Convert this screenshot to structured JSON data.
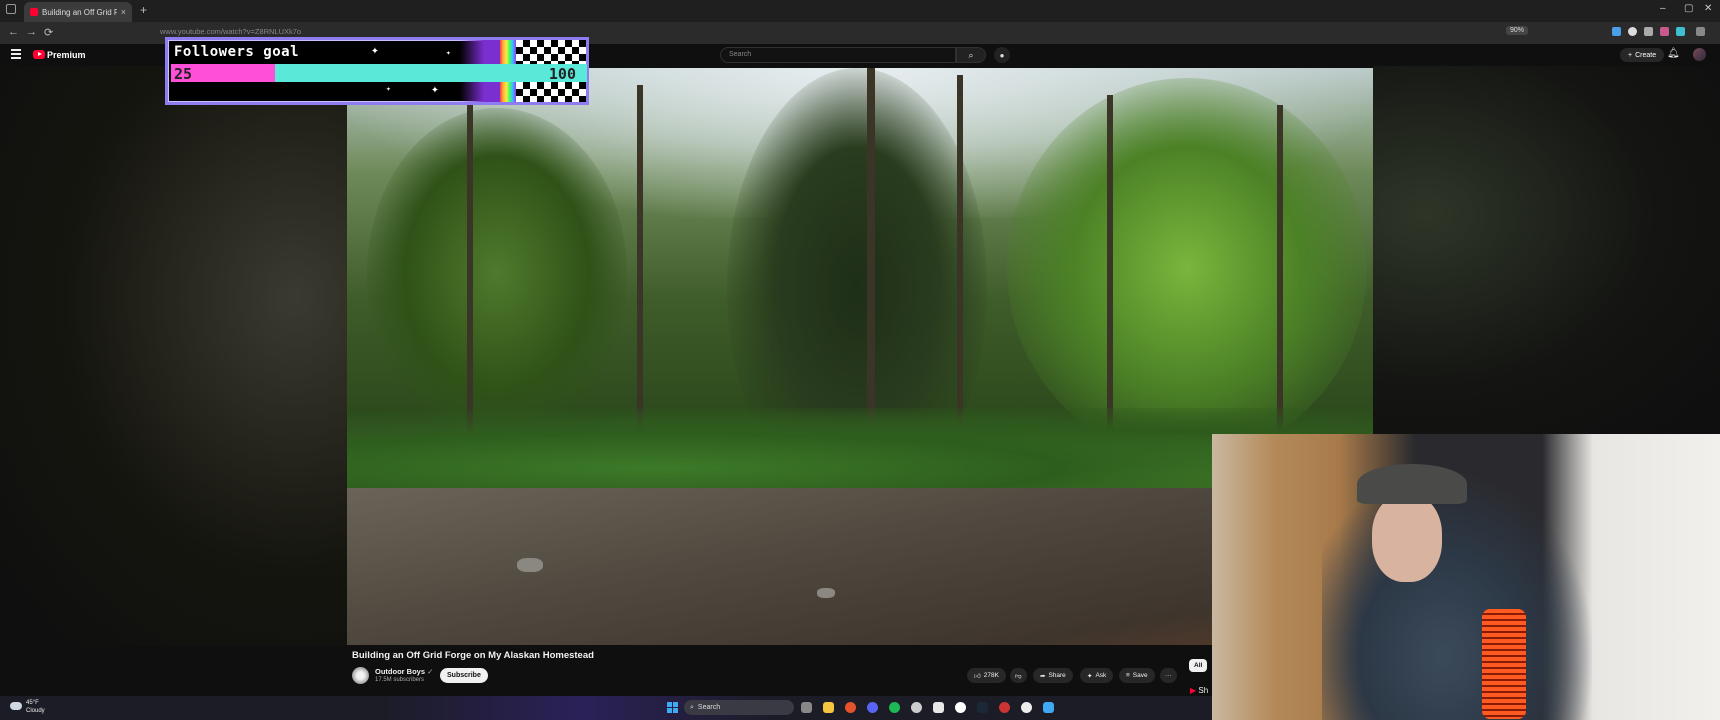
{
  "browser": {
    "tab_title": "Building an Off Grid Forge",
    "tab_close": "×",
    "new_tab": "+",
    "url": "www.youtube.com/watch?v=Z8RNLUXk7o",
    "zoom": "90%",
    "controls": {
      "minimize": "–",
      "maximize": "▢",
      "close": "✕"
    },
    "nav": {
      "back": "←",
      "forward": "→",
      "reload": "⟳"
    }
  },
  "youtube": {
    "logo_text": "Premium",
    "search_placeholder": "Search",
    "search_icon": "search-icon",
    "create_label": "Create",
    "bell_icon": "bell-icon"
  },
  "overlay_goal": {
    "label": "Followers goal",
    "current": "25",
    "target": "100",
    "progress_fraction": 0.25
  },
  "video": {
    "title": "Building an Off Grid Forge on My Alaskan Homestead",
    "channel": "Outdoor Boys",
    "verified_glyph": "✓",
    "subscribers": "17.5M subscribers",
    "subscribe_label": "Subscribe",
    "likes": "278K",
    "share_label": "Share",
    "ask_label": "Ask",
    "save_label": "Save",
    "more_glyph": "···",
    "chip_all": "All",
    "shorts_label": "Sh"
  },
  "taskbar": {
    "weather_temp": "45°F",
    "weather_desc": "Cloudy",
    "search_label": "Search"
  },
  "colors": {
    "yt_red": "#ff0033",
    "goal_pink": "#ff4fd8",
    "goal_teal": "#5ae8d8",
    "goal_border": "#8f7cf0"
  }
}
